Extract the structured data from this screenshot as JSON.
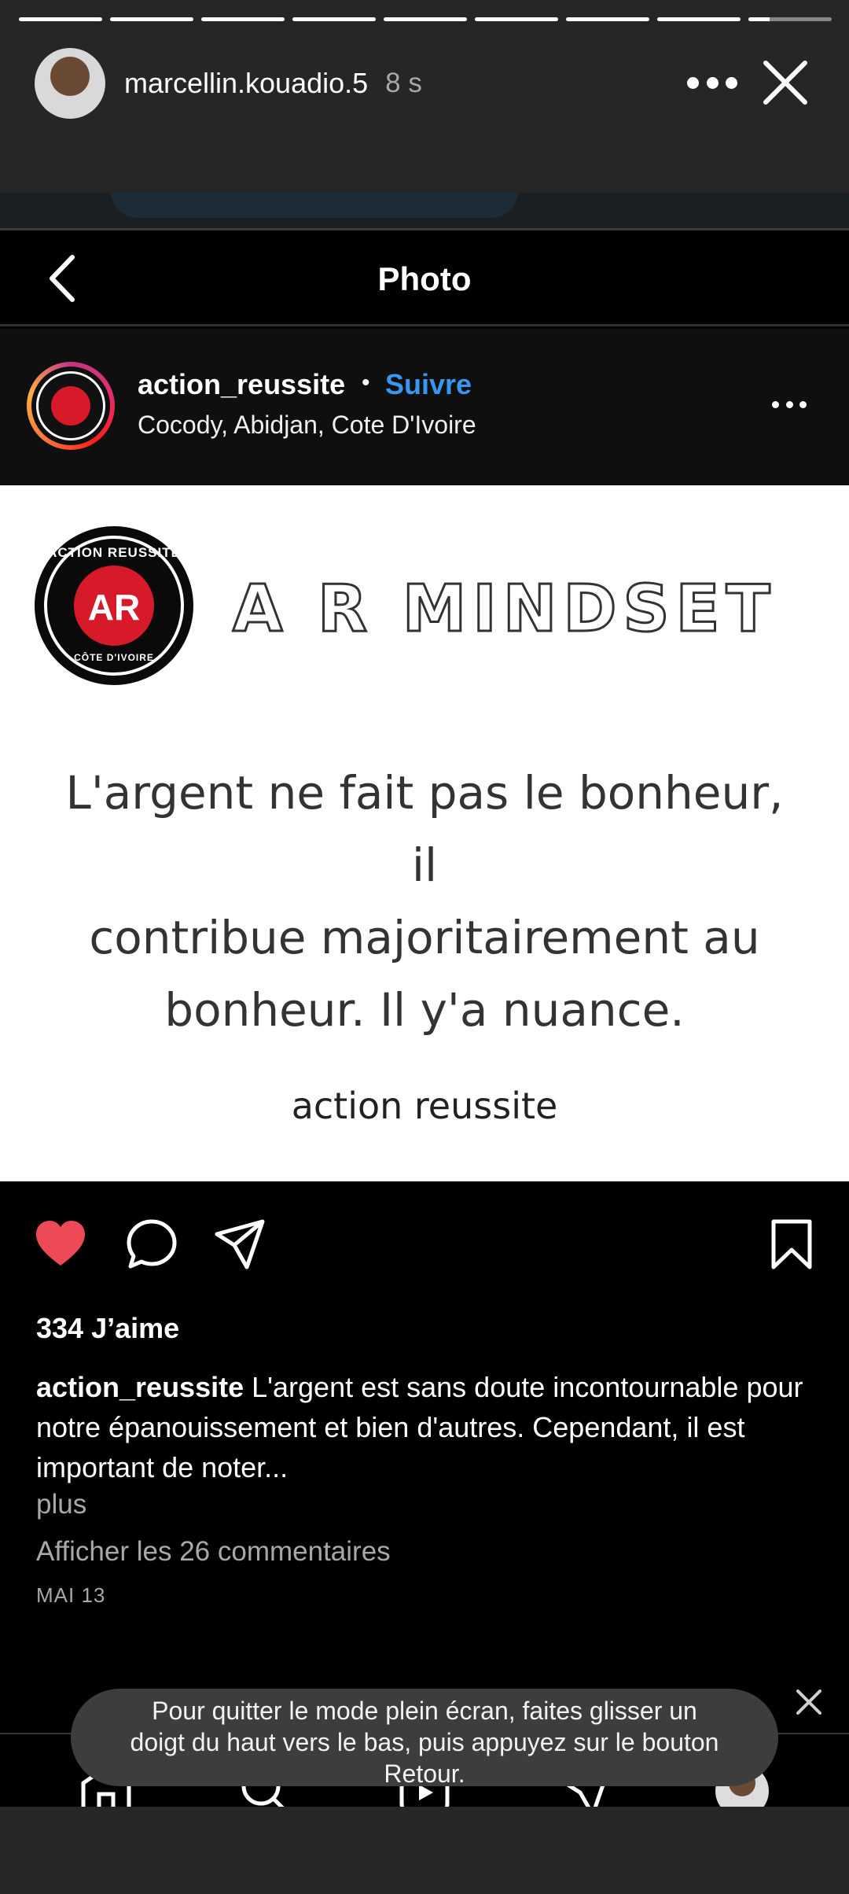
{
  "story": {
    "username": "marcellin.kouadio.5",
    "time": "8 s",
    "segments": 9,
    "current_segment_progress": 0.25
  },
  "post_screen": {
    "title": "Photo",
    "account": "action_reussite",
    "dot": "•",
    "follow_label": "Suivre",
    "location": "Cocody, Abidjan, Cote D'Ivoire"
  },
  "image": {
    "logo_top": "ACTION REUSSITE",
    "logo_mark": "AR",
    "logo_bottom": "CÔTE D'IVOIRE",
    "heading": "A R MINDSET",
    "quote_line1": "L'argent ne fait pas le bonheur, il",
    "quote_line2": "contribue majoritairement au",
    "quote_line3": "bonheur. Il y'a nuance.",
    "signature": "action reussite"
  },
  "engagement": {
    "likes": "334 J’aime",
    "caption_user": "action_reussite",
    "caption_text": " L'argent est sans doute incontournable pour notre épanouissement et bien d'autres. Cependant, il est important de noter...",
    "more": "plus",
    "view_comments": "Afficher les 26 commentaires",
    "date": "MAI 13"
  },
  "toast": {
    "line1": "Pour quitter le mode plein écran, faites glisser un",
    "line2": "doigt du haut vers le bas, puis appuyez sur le bouton",
    "line3": "Retour."
  },
  "icons": {
    "close": "close-icon",
    "more": "more-icon",
    "back": "back-icon",
    "like": "heart-icon",
    "comment": "comment-icon",
    "share": "send-icon",
    "save": "bookmark-icon"
  },
  "colors": {
    "accent_blue": "#3897f0",
    "like_red": "#ed4956",
    "background": "#000000"
  }
}
